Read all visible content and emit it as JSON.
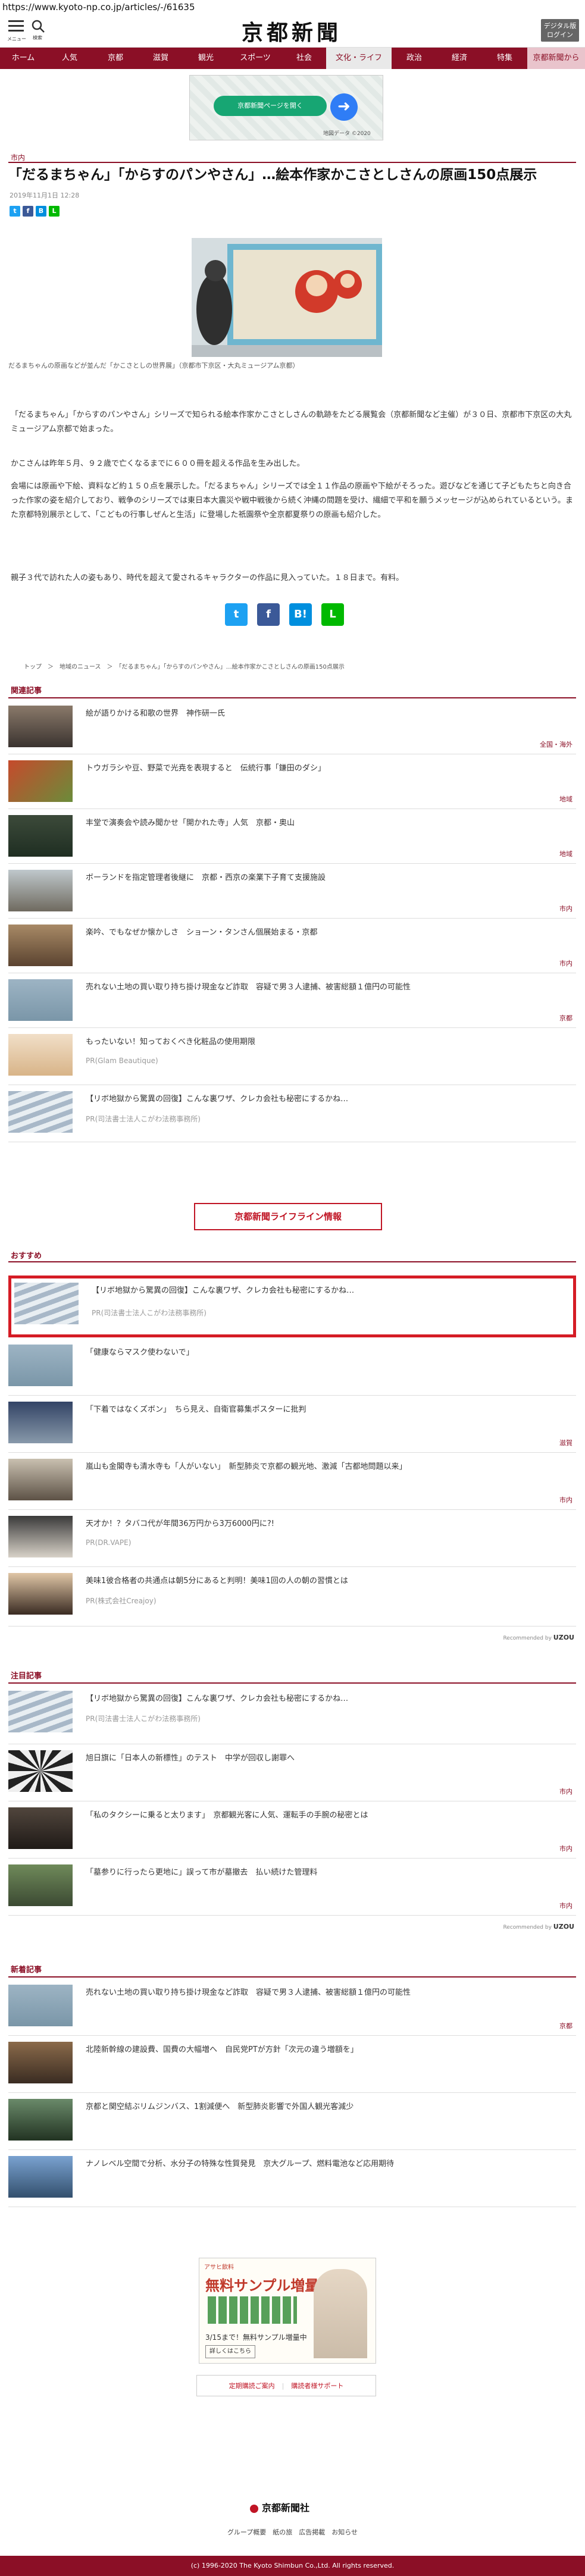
{
  "url": "https://www.kyoto-np.co.jp/articles/-/61635",
  "header": {
    "menu_label": "メニュー",
    "search_label": "検索",
    "logo": "京都新聞",
    "digital_label": "デジタル版ログイン"
  },
  "nav": [
    "ホーム",
    "人気",
    "京都",
    "滋賀",
    "観光",
    "スポーツ",
    "社会",
    "文化・ライフ",
    "政治",
    "経済",
    "特集",
    "京都新聞から"
  ],
  "ad_top": {
    "button": "京都新聞ページを開く",
    "note": "地図データ ©2020"
  },
  "article": {
    "category": "市内",
    "title": "「だるまちゃん」「からすのパンやさん」…絵本作家かこさとしさんの原画150点展示",
    "date": "2019年11月1日 12:28",
    "caption": "だるまちゃんの原画などが並んだ「かこさとしの世界展」（京都市下京区・大丸ミュージアム京都）",
    "paragraphs": [
      "「だるまちゃん」「からすのパンやさん」シリーズで知られる絵本作家かこさとしさんの軌跡をたどる展覧会（京都新聞など主催）が３０日、京都市下京区の大丸ミュージアム京都で始まった。",
      "かこさんは昨年５月、９２歳で亡くなるまでに６００冊を超える作品を生み出した。",
      "会場には原画や下絵、資料など約１５０点を展示した。「だるまちゃん」シリーズでは全１１作品の原画や下絵がそろった。遊びなどを通じて子どもたちと向き合った作家の姿を紹介しており、戦争のシリーズでは東日本大震災や戦中戦後から続く沖縄の問題を受け、繊細で平和を願うメッセージが込められているという。また京都特別展示として、「こどもの行事しぜんと生活」に登場した祇園祭や全京都夏祭りの原画も紹介した。",
      "親子３代で訪れた人の姿もあり、時代を超えて愛されるキャラクターの作品に見入っていた。１８日まで。有料。"
    ],
    "breadcrumb": "トップ　＞　地域のニュース　＞　「だるまちゃん」「からすのパンやさん」…絵本作家かこさとしさんの原画150点展示"
  },
  "related": {
    "heading": "関連記事",
    "items": [
      {
        "title": "絵が語りかける和歌の世界　神作研一氏",
        "tag": "全国・海外"
      },
      {
        "title": "トウガラシや豆、野菜で光尭を表現すると　伝統行事「鎌田のダシ」",
        "tag": "地域"
      },
      {
        "title": "丰堂で演奏会や読み聞かせ「開かれた寺」人気　京都・奥山",
        "tag": "地域"
      },
      {
        "title": "ボーランドを指定管理者後継に　京都・西京の楽業下子育て支援施設",
        "tag": "市内"
      },
      {
        "title": "楽吟、でもなぜか懐かしさ　ショーン・タンさん個展始まる・京都",
        "tag": "市内"
      },
      {
        "title": "売れない土地の買い取り持ち掛け現金など詐取　容疑で男３人逮捕、被害総額１億円の可能性",
        "tag": "京都"
      },
      {
        "title": "もったいない！知っておくべき化粧品の使用期限",
        "pr": "PR(Glam Beautique)"
      },
      {
        "title": "【リボ地獄から驚異の回復】こんな裏ワザ、クレカ会社も秘密にするかね…",
        "pr": "PR(司法書士法人こがわ法務事務所)"
      }
    ]
  },
  "life_button": "京都新聞ライフライン情報",
  "recommend": {
    "heading": "おすすめ",
    "items": [
      {
        "title": "【リボ地獄から驚異の回復】こんな裏ワザ、クレカ会社も秘密にするかね…",
        "pr": "PR(司法書士法人こがわ法務事務所)"
      },
      {
        "title": "「健康ならマスク使わないで」",
        "tag": ""
      },
      {
        "title": "「下着ではなくズボン」　ちら見え、自衛官募集ポスターに批判",
        "tag": "滋賀"
      },
      {
        "title": "嵐山も金閣寺も清水寺も「人がいない」　新型肺炎で京都の観光地、激減「古都地問題以来」",
        "tag": "市内"
      },
      {
        "title": "天才か！？タバコ代が年間36万円から3万6000円に?!",
        "pr": "PR(DR.VAPE)"
      },
      {
        "title": "美味1彼合格者の共通点は朝5分にあると判明！美味1回の人の朝の習慣とは",
        "pr": "PR(株式会社Creajoy)"
      }
    ],
    "recommended_by": "Recommended by",
    "brand": "UZOU"
  },
  "featured": {
    "heading": "注目記事",
    "items": [
      {
        "title": "【リボ地獄から驚異の回復】こんな裏ワザ、クレカ会社も秘密にするかね…",
        "pr": "PR(司法書士法人こがわ法務事務所)"
      },
      {
        "title": "旭日旗に「日本人の新標性」のテスト　中学が回収し謝罪へ",
        "tag": "市内"
      },
      {
        "title": "「私のタクシーに乗ると太ります」　京都観光客に人気、運転手の手腕の秘密とは",
        "tag": "市内"
      },
      {
        "title": "「墓参りに行ったら更地に」誤って市が墓撤去　払い続けた管理料",
        "tag": "市内"
      }
    ]
  },
  "new": {
    "heading": "新着記事",
    "items": [
      {
        "title": "売れない土地の買い取り持ち掛け現金など詐取　容疑で男３人逮捕、被害総額１億円の可能性",
        "tag": "京都"
      },
      {
        "title": "北陸新幹線の建設費、国費の大幅増へ　自民党PTが方針「次元の違う増額を」",
        "tag": ""
      },
      {
        "title": "京都と関空結ぶリムジンバス、1割減便へ　新型肺炎影響で外国人観光客減少",
        "tag": ""
      },
      {
        "title": "ナノレベル空間で分析、水分子の特殊な性質発見　京大グループ、燃料電池など応用期待",
        "tag": ""
      }
    ]
  },
  "ad_bottom": {
    "brand": "アサヒ飲料",
    "headline": "無料サンプル増量中",
    "sub": "3/15まで！無料サンプル増量中",
    "btn": "詳しくはこちら"
  },
  "footer": {
    "link1": "定期購読ご案内",
    "link2": "購読者様サポート",
    "logo": "京都新聞社",
    "nav": "グループ概要　紙の旅　広告掲載　お知らせ",
    "copy": "(c) 1996-2020 The Kyoto Shimbun Co.,Ltd. All rights reserved."
  }
}
